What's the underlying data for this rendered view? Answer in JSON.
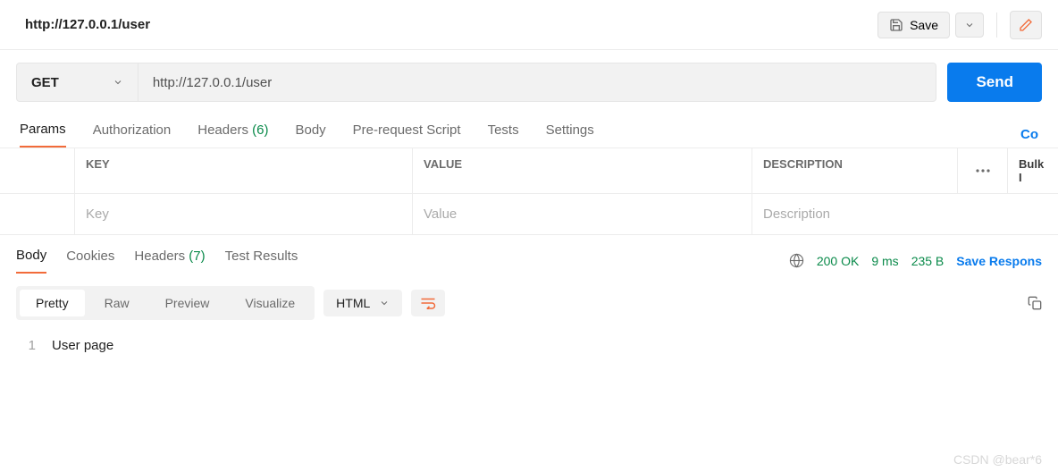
{
  "header": {
    "title": "http://127.0.0.1/user",
    "save_label": "Save"
  },
  "request": {
    "method": "GET",
    "url": "http://127.0.0.1/user",
    "send_label": "Send",
    "tabs": [
      {
        "label": "Params",
        "active": true
      },
      {
        "label": "Authorization"
      },
      {
        "label": "Headers",
        "count": "(6)"
      },
      {
        "label": "Body"
      },
      {
        "label": "Pre-request Script"
      },
      {
        "label": "Tests"
      },
      {
        "label": "Settings"
      }
    ],
    "cookies_link": "Co"
  },
  "params_table": {
    "headers": {
      "key": "KEY",
      "value": "VALUE",
      "description": "DESCRIPTION",
      "bulk": "Bulk I"
    },
    "placeholders": {
      "key": "Key",
      "value": "Value",
      "description": "Description"
    }
  },
  "response": {
    "tabs": [
      {
        "label": "Body",
        "active": true
      },
      {
        "label": "Cookies"
      },
      {
        "label": "Headers",
        "count": "(7)"
      },
      {
        "label": "Test Results"
      }
    ],
    "status": "200 OK",
    "time": "9 ms",
    "size": "235 B",
    "save_label": "Save Respons",
    "views": [
      {
        "label": "Pretty",
        "active": true
      },
      {
        "label": "Raw"
      },
      {
        "label": "Preview"
      },
      {
        "label": "Visualize"
      }
    ],
    "format": "HTML",
    "body_lines": [
      {
        "n": "1",
        "text": "User page"
      }
    ]
  },
  "watermark": "CSDN @bear*6"
}
